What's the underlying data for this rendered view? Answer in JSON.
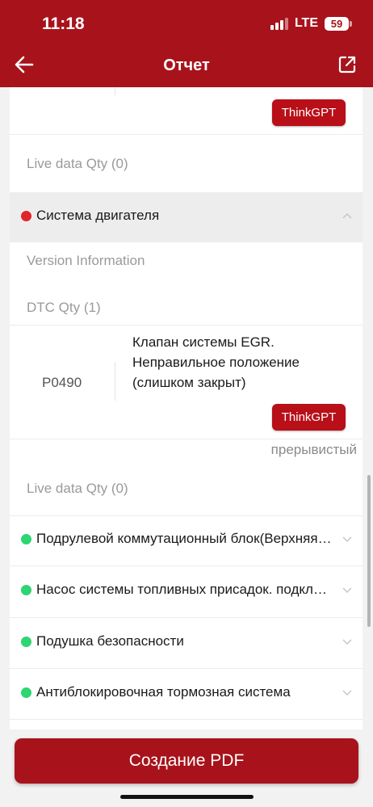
{
  "status_bar": {
    "time": "11:18",
    "network": "LTE",
    "battery": "59"
  },
  "header": {
    "title": "Отчет",
    "back_icon": "arrow-left-icon",
    "share_icon": "share-external-icon"
  },
  "think_gpt_label": "ThinkGPT",
  "live_data_1": "Live data Qty (0)",
  "engine_section": {
    "label": "Система двигателя",
    "status_color": "#e0262c",
    "version_info": "Version Information",
    "dtc_qty": "DTC Qty (1)",
    "dtc": {
      "code": "P0490",
      "description": "Клапан системы EGR. Неправильное положение (слишком закрыт)",
      "status": "прерывистый"
    },
    "live_data": "Live data Qty (0)"
  },
  "systems": [
    {
      "label": "Подрулевой коммутационный блок(Верхняя колонка)",
      "status_color": "#2ed573"
    },
    {
      "label": "Насос системы топливных присадок. подключение",
      "status_color": "#2ed573"
    },
    {
      "label": "Подушка безопасности",
      "status_color": "#2ed573"
    },
    {
      "label": "Антиблокировочная тормозная система",
      "status_color": "#2ed573"
    }
  ],
  "pdf_button": "Создание PDF",
  "colors": {
    "brand_red": "#a8131b",
    "gpt_red": "#b90f18"
  }
}
